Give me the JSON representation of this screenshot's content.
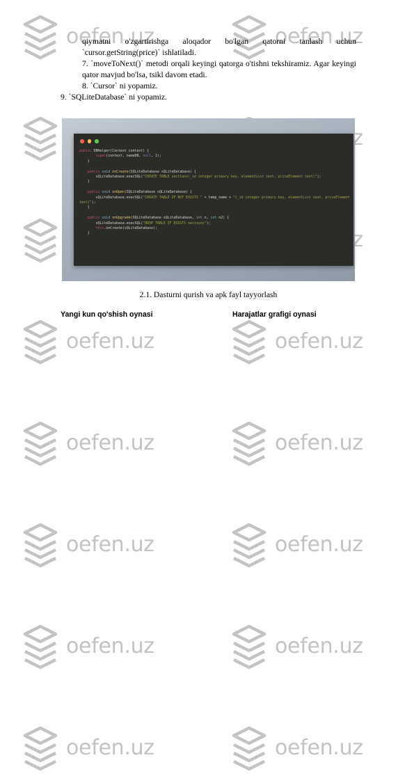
{
  "watermark": {
    "text": "oefen.uz",
    "icon": "stacked-layers-icon",
    "color": "#c3c3c3"
  },
  "document": {
    "paragraphs": [
      {
        "id": "p1",
        "indent": true,
        "justified": true,
        "text": "qiymatni o'zgartirishga aloqador bo'lgan qatorni tanlash uchun `cursor.getString(price)` ishlatiladi."
      },
      {
        "id": "p2",
        "indent": true,
        "justified": true,
        "text": "7. `moveToNext()` metodi orqali keyingi qatorga o'tishni tekshiramiz. Agar keyingi qator mavjud bo'lsa, tsikl davom etadi."
      },
      {
        "id": "p3",
        "indent": true,
        "justified": false,
        "text": "8. `Cursor` ni yopamiz."
      },
      {
        "id": "p4",
        "indent": false,
        "justified": false,
        "text": "9. `SQLiteDatabase` ni yopamiz."
      }
    ],
    "figure_caption": "2.1. Dasturni qurish va apk fayl tayyorlash",
    "heading_left": "Yangi kun qo'shish oynasi",
    "heading_right": "Harajatlar grafigi oynasi"
  },
  "figure": {
    "window_controls": [
      "close-red",
      "minimize-yellow",
      "maximize-green"
    ],
    "background_color": "#a6b1bd",
    "panel_color": "#2b2b28",
    "code_language": "java",
    "code_lines": [
      {
        "segments": [
          {
            "cls": "kw2",
            "t": "public "
          },
          {
            "cls": "punct",
            "t": "DBHelper(Context context) {"
          }
        ]
      },
      {
        "segments": [
          {
            "cls": "punct",
            "t": "        "
          },
          {
            "cls": "kw2",
            "t": "super"
          },
          {
            "cls": "punct",
            "t": "(context, nameDB, "
          },
          {
            "cls": "lit",
            "t": "null"
          },
          {
            "cls": "punct",
            "t": ", 1);"
          }
        ]
      },
      {
        "segments": [
          {
            "cls": "punct",
            "t": "    }"
          }
        ]
      },
      {
        "segments": []
      },
      {
        "segments": [
          {
            "cls": "punct",
            "t": "    "
          },
          {
            "cls": "kw2",
            "t": "public "
          },
          {
            "cls": "type",
            "t": "void "
          },
          {
            "cls": "fn",
            "t": "onCreate"
          },
          {
            "cls": "punct",
            "t": "(SQLiteDatabase sQLiteDatabase) {"
          }
        ]
      },
      {
        "segments": [
          {
            "cls": "punct",
            "t": "        sQLiteDatabase.execSQL("
          },
          {
            "cls": "str",
            "t": "\"CREATE TABLE sections(_id integer primary key, elementList text, priceElement text)\""
          },
          {
            "cls": "punct",
            "t": ");"
          }
        ]
      },
      {
        "segments": [
          {
            "cls": "punct",
            "t": "    }"
          }
        ]
      },
      {
        "segments": []
      },
      {
        "segments": [
          {
            "cls": "punct",
            "t": "    "
          },
          {
            "cls": "kw2",
            "t": "public "
          },
          {
            "cls": "type",
            "t": "void "
          },
          {
            "cls": "fn",
            "t": "onOpen"
          },
          {
            "cls": "punct",
            "t": "(SQLiteDatabase sQLiteDatabase) {"
          }
        ]
      },
      {
        "segments": [
          {
            "cls": "punct",
            "t": "        sQLiteDatabase.execSQL("
          },
          {
            "cls": "str",
            "t": "\"CREATE TABLE IF NOT EXISTS \""
          },
          {
            "cls": "punct",
            "t": " + temp_name + "
          },
          {
            "cls": "str",
            "t": "\"(_id integer primary key, elementList text, priceElement text)\""
          },
          {
            "cls": "punct",
            "t": ");"
          }
        ]
      },
      {
        "segments": [
          {
            "cls": "punct",
            "t": "    }"
          }
        ]
      },
      {
        "segments": []
      },
      {
        "segments": [
          {
            "cls": "punct",
            "t": "    "
          },
          {
            "cls": "kw2",
            "t": "public "
          },
          {
            "cls": "type",
            "t": "void "
          },
          {
            "cls": "fn",
            "t": "onUpgrade"
          },
          {
            "cls": "punct",
            "t": "(SQLiteDatabase sQLiteDatabase, "
          },
          {
            "cls": "type",
            "t": "int"
          },
          {
            "cls": "punct",
            "t": " n, "
          },
          {
            "cls": "type",
            "t": "int"
          },
          {
            "cls": "punct",
            "t": " n2) {"
          }
        ]
      },
      {
        "segments": [
          {
            "cls": "punct",
            "t": "        sQLiteDatabase.execSQL("
          },
          {
            "cls": "str",
            "t": "\"DROP TABLE IF EXISTS sections\""
          },
          {
            "cls": "punct",
            "t": ");"
          }
        ]
      },
      {
        "segments": [
          {
            "cls": "punct",
            "t": "        "
          },
          {
            "cls": "kwthis",
            "t": "this"
          },
          {
            "cls": "punct",
            "t": ".onCreate(sQLiteDatabase);"
          }
        ]
      },
      {
        "segments": [
          {
            "cls": "punct",
            "t": "    }"
          }
        ]
      }
    ]
  }
}
